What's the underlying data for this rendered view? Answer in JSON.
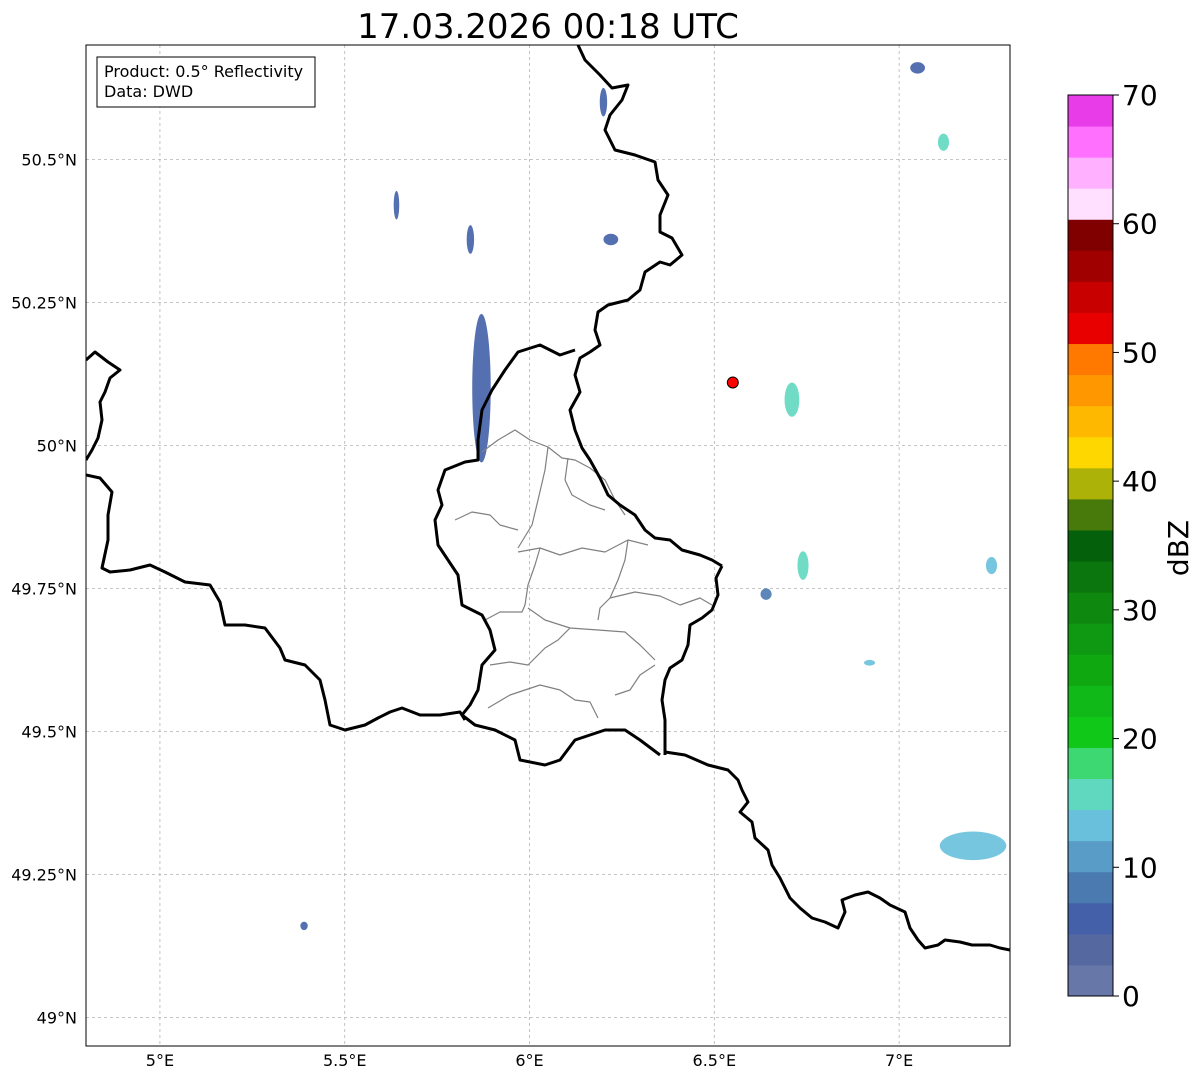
{
  "title": "17.03.2026 00:18 UTC",
  "info_box": {
    "product": "Product: 0.5° Reflectivity",
    "data": "Data: DWD"
  },
  "axes": {
    "lon_ticks": [
      {
        "value": 5.0,
        "label": "5°E"
      },
      {
        "value": 5.5,
        "label": "5.5°E"
      },
      {
        "value": 6.0,
        "label": "6°E"
      },
      {
        "value": 6.5,
        "label": "6.5°E"
      },
      {
        "value": 7.0,
        "label": "7°E"
      }
    ],
    "lat_ticks": [
      {
        "value": 49.0,
        "label": "49°N"
      },
      {
        "value": 49.25,
        "label": "49.25°N"
      },
      {
        "value": 49.5,
        "label": "49.5°N"
      },
      {
        "value": 49.75,
        "label": "49.75°N"
      },
      {
        "value": 50.0,
        "label": "50°N"
      },
      {
        "value": 50.25,
        "label": "50.25°N"
      },
      {
        "value": 50.5,
        "label": "50.5°N"
      }
    ],
    "lon_range": [
      4.8,
      7.3
    ],
    "lat_range": [
      48.95,
      50.7
    ],
    "grid": true
  },
  "colorbar": {
    "unit": "dBZ",
    "min": 0,
    "max": 70,
    "tick_labels": [
      {
        "value": 0,
        "label": "0"
      },
      {
        "value": 10,
        "label": "10"
      },
      {
        "value": 20,
        "label": "20"
      },
      {
        "value": 30,
        "label": "30"
      },
      {
        "value": 40,
        "label": "40"
      },
      {
        "value": 50,
        "label": "50"
      },
      {
        "value": 60,
        "label": "60"
      },
      {
        "value": 70,
        "label": "70"
      }
    ],
    "colors": [
      "#6677a8",
      "#5568a0",
      "#4360a8",
      "#4a7ab0",
      "#5a9cc8",
      "#68c0dc",
      "#60d8c0",
      "#3ed872",
      "#10c818",
      "#10b818",
      "#10a810",
      "#0f9812",
      "#0e880e",
      "#0a760d",
      "#05600c",
      "#477a0a",
      "#adb208",
      "#ffd700",
      "#ffb800",
      "#ff9800",
      "#ff7800",
      "#e80000",
      "#c80000",
      "#a00000",
      "#800000",
      "#ffe0ff",
      "#ffb0ff",
      "#ff70ff",
      "#e83ce8"
    ]
  },
  "marker": {
    "lon": 6.55,
    "lat": 50.11,
    "color": "#ff0000"
  },
  "colors": {
    "thick_border": "#000000",
    "thin_border": "#808080",
    "grid": "#b3b3b3"
  },
  "echoes": [
    {
      "lon": 5.87,
      "lat": 50.1,
      "w": 0.05,
      "h": 0.26,
      "level": 2
    },
    {
      "lon": 5.84,
      "lat": 50.36,
      "w": 0.02,
      "h": 0.05,
      "level": 2
    },
    {
      "lon": 5.64,
      "lat": 50.42,
      "w": 0.015,
      "h": 0.05,
      "level": 2
    },
    {
      "lon": 6.71,
      "lat": 50.08,
      "w": 0.04,
      "h": 0.06,
      "level": 6
    },
    {
      "lon": 6.74,
      "lat": 49.79,
      "w": 0.03,
      "h": 0.05,
      "level": 6
    },
    {
      "lon": 6.22,
      "lat": 50.36,
      "w": 0.04,
      "h": 0.02,
      "level": 2
    },
    {
      "lon": 6.2,
      "lat": 50.6,
      "w": 0.02,
      "h": 0.05,
      "level": 2
    },
    {
      "lon": 7.05,
      "lat": 50.66,
      "w": 0.04,
      "h": 0.02,
      "level": 2
    },
    {
      "lon": 7.12,
      "lat": 50.53,
      "w": 0.03,
      "h": 0.03,
      "level": 6
    },
    {
      "lon": 7.2,
      "lat": 49.3,
      "w": 0.18,
      "h": 0.05,
      "level": 5
    },
    {
      "lon": 7.25,
      "lat": 49.79,
      "w": 0.03,
      "h": 0.03,
      "level": 5
    },
    {
      "lon": 5.39,
      "lat": 49.16,
      "w": 0.02,
      "h": 0.015,
      "level": 2
    },
    {
      "lon": 6.92,
      "lat": 49.62,
      "w": 0.03,
      "h": 0.01,
      "level": 5
    },
    {
      "lon": 6.64,
      "lat": 49.74,
      "w": 0.03,
      "h": 0.02,
      "level": 3
    }
  ]
}
